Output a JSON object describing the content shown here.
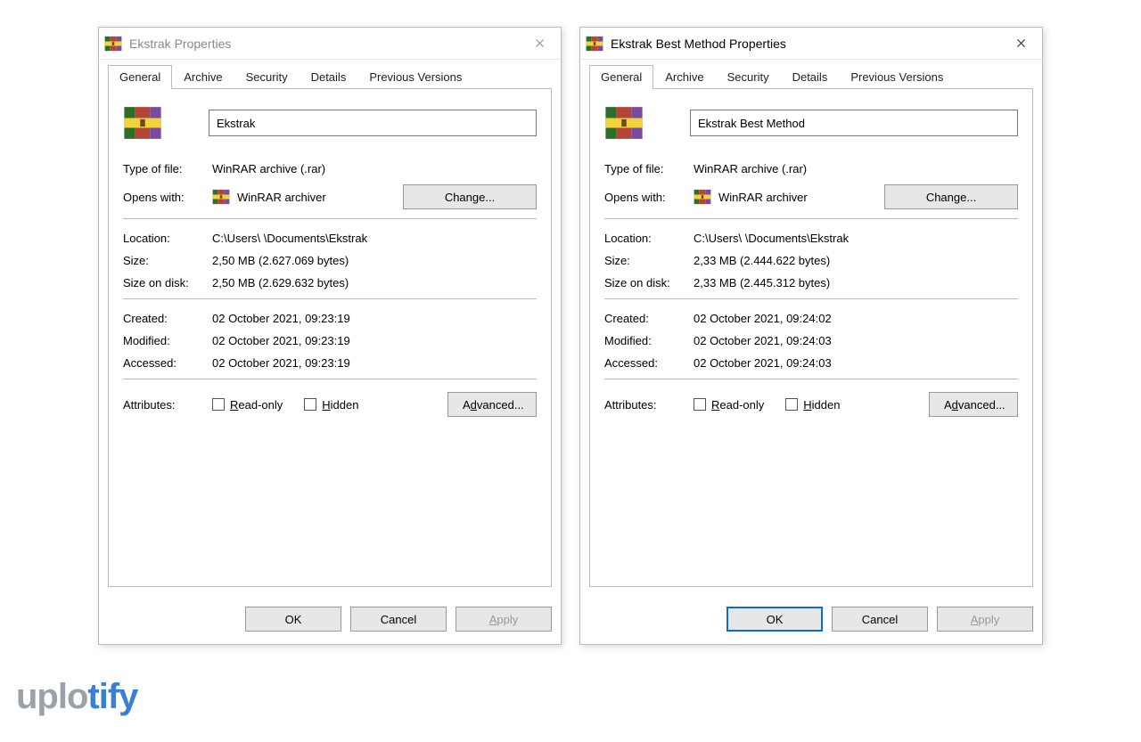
{
  "tabs": [
    "General",
    "Archive",
    "Security",
    "Details",
    "Previous Versions"
  ],
  "labels": {
    "type_of_file": "Type of file:",
    "opens_with": "Opens with:",
    "location": "Location:",
    "size": "Size:",
    "size_on_disk": "Size on disk:",
    "created": "Created:",
    "modified": "Modified:",
    "accessed": "Accessed:",
    "attributes": "Attributes:",
    "read_only": "Read-only",
    "hidden": "Hidden",
    "change": "Change...",
    "advanced": "Advanced...",
    "ok": "OK",
    "cancel": "Cancel",
    "apply": "Apply"
  },
  "opens_with_app": "WinRAR archiver",
  "file_type_value": "WinRAR archive (.rar)",
  "dialogs": [
    {
      "active": false,
      "title": "Ekstrak Properties",
      "name": "Ekstrak",
      "location": "C:\\Users\\         \\Documents\\Ekstrak",
      "size": "2,50 MB (2.627.069 bytes)",
      "size_on_disk": "2,50 MB (2.629.632 bytes)",
      "created": "02 October 2021, 09:23:19",
      "modified": "02 October 2021, 09:23:19",
      "accessed": "02 October 2021, 09:23:19"
    },
    {
      "active": true,
      "title": "Ekstrak Best Method Properties",
      "name": "Ekstrak Best Method",
      "location": "C:\\Users\\         \\Documents\\Ekstrak",
      "size": "2,33 MB (2.444.622 bytes)",
      "size_on_disk": "2,33 MB (2.445.312 bytes)",
      "created": "02 October 2021, 09:24:02",
      "modified": "02 October 2021, 09:24:03",
      "accessed": "02 October 2021, 09:24:03"
    }
  ],
  "watermark": {
    "part1": "uplo",
    "part2": "tify"
  }
}
